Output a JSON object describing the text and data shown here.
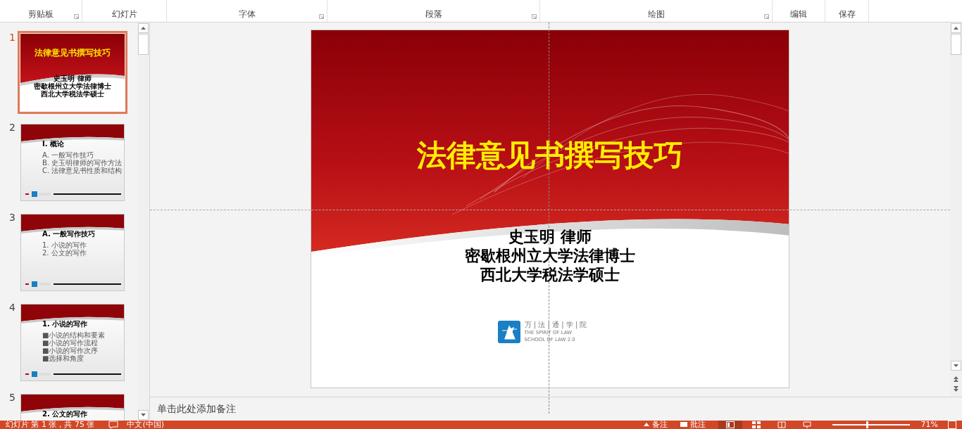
{
  "ribbon": {
    "groups": [
      {
        "label": "剪贴板",
        "launcher": true
      },
      {
        "label": "幻灯片",
        "launcher": false
      },
      {
        "label": "字体",
        "launcher": true
      },
      {
        "label": "段落",
        "launcher": true
      },
      {
        "label": "绘图",
        "launcher": true
      },
      {
        "label": "编辑",
        "launcher": false
      },
      {
        "label": "保存",
        "launcher": false
      }
    ]
  },
  "slides": [
    {
      "number": "1",
      "selected": true,
      "kind": "title",
      "title": "法律意见书撰写技巧",
      "lines": [
        "史玉明 律师",
        "密歇根州立大学法律博士",
        "西北大学税法学硕士"
      ]
    },
    {
      "number": "2",
      "selected": false,
      "kind": "content",
      "title": "I. 概论",
      "bullets": [
        "A. 一般写作技巧",
        "B. 史玉明律师的写作方法",
        "C. 法律意见书性质和结构"
      ]
    },
    {
      "number": "3",
      "selected": false,
      "kind": "content",
      "title": "A. 一般写作技巧",
      "bullets": [
        "1. 小说的写作",
        "2. 公文的写作"
      ]
    },
    {
      "number": "4",
      "selected": false,
      "kind": "content",
      "title": "1. 小说的写作",
      "bullets": [
        "■小说的结构和要素",
        "■小说的写作流程",
        "■小说的写作次序",
        "■选择和角度"
      ]
    },
    {
      "number": "5",
      "selected": false,
      "kind": "content",
      "title": "2. 公文的写作"
    }
  ],
  "editor": {
    "title": "法律意见书撰写技巧",
    "lines": [
      "史玉明 律师",
      "密歇根州立大学法律博士",
      "西北大学税法学硕士"
    ],
    "logo": {
      "name": "万 | 法 | 通 | 学 | 院",
      "lines": [
        "THE SPIRIT OF LAW",
        "SCHOOL OF LAW 2.0"
      ]
    }
  },
  "notes": {
    "placeholder": "单击此处添加备注"
  },
  "status_bar": {
    "slide_info": "幻灯片 第 1 张，共 75 张",
    "language": "中文(中国)",
    "notes": "备注",
    "comments": "批注",
    "zoom": "71%",
    "zoom_slider": {
      "level": 0.45
    }
  }
}
